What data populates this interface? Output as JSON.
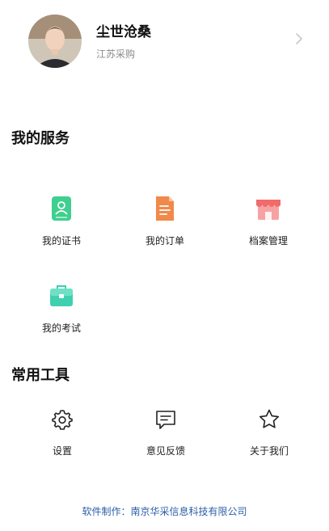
{
  "profile": {
    "name": "尘世沧桑",
    "org": "江苏采购"
  },
  "services": {
    "title": "我的服务",
    "items": [
      {
        "label": "我的证书",
        "icon": "certificate-icon",
        "color": "#3fcf8e"
      },
      {
        "label": "我的订单",
        "icon": "order-document-icon",
        "color": "#f0894a"
      },
      {
        "label": "档案管理",
        "icon": "storefront-icon",
        "color": "#f26b6b"
      },
      {
        "label": "我的考试",
        "icon": "briefcase-icon",
        "color": "#3fd0b0"
      }
    ]
  },
  "tools": {
    "title": "常用工具",
    "items": [
      {
        "label": "设置",
        "icon": "gear-icon"
      },
      {
        "label": "意见反馈",
        "icon": "feedback-icon"
      },
      {
        "label": "关于我们",
        "icon": "star-icon"
      }
    ]
  },
  "footer": {
    "text": "软件制作：南京华采信息科技有限公司"
  }
}
